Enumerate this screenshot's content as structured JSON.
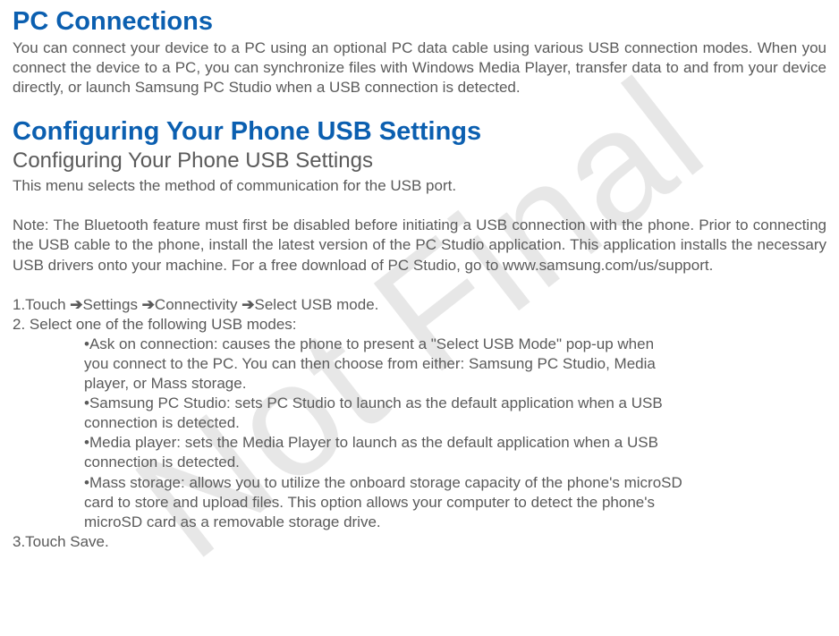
{
  "watermark": "Not Final",
  "section1": {
    "title": "PC Connections",
    "p1": "You can connect your device to a PC using an optional PC data cable using various USB connection modes. When you connect the device to a PC, you can synchronize files with Windows Media Player, transfer data to and from your device directly, or launch Samsung PC Studio when a USB connection is detected."
  },
  "section2": {
    "title": "Configuring Your Phone USB Settings",
    "subtitle": "Configuring Your Phone USB Settings",
    "p1": "This menu selects the method of communication for the USB port.",
    "p2": "Note: The Bluetooth feature must first be disabled before initiating a USB connection with the phone. Prior to connecting the USB cable to the phone, install the latest version of the PC Studio application. This application installs the necessary USB drivers onto your machine. For a free download of PC Studio, go to www.samsung.com/us/support.",
    "step1a": "1.Touch    ",
    "step1b": "Settings ",
    "step1c": "Connectivity ",
    "step1d": "Select USB mode.",
    "arrow": "➔",
    "step2": "2. Select one of the following USB modes:",
    "bullet1": "•Ask on connection: causes the phone to present a \"Select USB Mode\" pop-up when",
    "bullet1b": "  you connect to the PC. You can then choose from either: Samsung PC Studio, Media",
    "bullet1c": "player, or Mass storage.",
    "bullet2": "•Samsung PC Studio: sets PC Studio to launch as the default application when a USB",
    "bullet2b": "connection is detected.",
    "bullet3": "•Media player: sets the Media Player to launch as the default application when a USB",
    "bullet3b": "connection is detected.",
    "bullet4": "•Mass storage: allows you to utilize the onboard storage capacity of the phone's microSD",
    "bullet4b": "card to store and upload files. This option allows your computer to detect the phone's",
    "bullet4c": "microSD card as a removable storage drive.",
    "step3": "3.Touch Save."
  }
}
